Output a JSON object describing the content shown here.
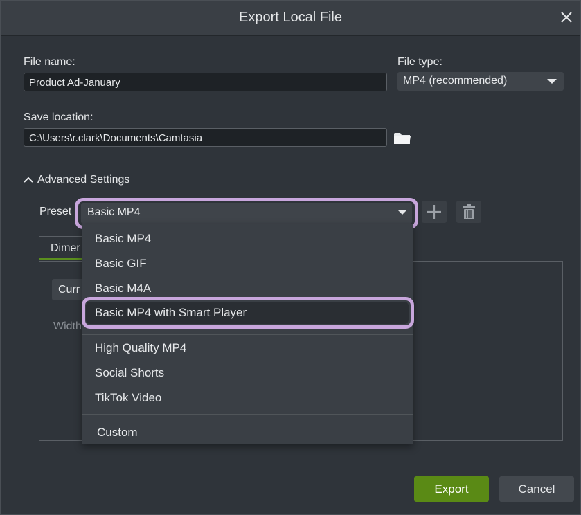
{
  "dialog": {
    "title": "Export Local File"
  },
  "file_name": {
    "label": "File name:",
    "value": "Product Ad-January"
  },
  "file_type": {
    "label": "File type:",
    "value": "MP4 (recommended)"
  },
  "save_location": {
    "label": "Save location:",
    "value": "C:\\Users\\r.clark\\Documents\\Camtasia"
  },
  "advanced": {
    "label": "Advanced Settings",
    "preset_label": "Preset",
    "preset_value": "Basic MP4",
    "tab_label": "Dimer",
    "current_button": "Curr",
    "width_label": "Width"
  },
  "preset_options": [
    "Basic MP4",
    "Basic GIF",
    "Basic M4A",
    "Basic MP4 with Smart Player",
    "High Quality MP4",
    "Social Shorts",
    "TikTok Video",
    "Custom"
  ],
  "footer": {
    "export_label": "Export",
    "cancel_label": "Cancel"
  },
  "colors": {
    "highlight": "#c8a6dc",
    "export_green": "#5a8a15",
    "tab_underline": "#5b8f1e"
  },
  "icons": [
    "close-icon",
    "caret-down-icon",
    "folder-icon",
    "chevron-up-icon",
    "plus-icon",
    "trash-icon"
  ]
}
